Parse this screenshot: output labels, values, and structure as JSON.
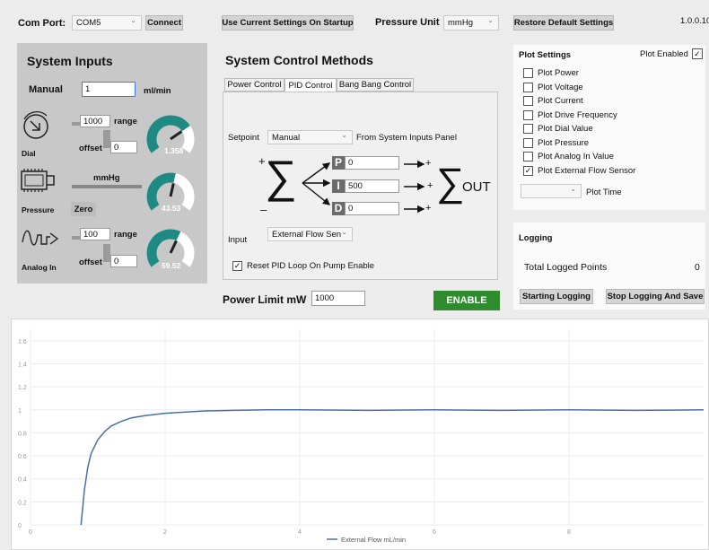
{
  "topbar": {
    "com_port_label": "Com Port:",
    "com_port_value": "COM5",
    "connect_label": "Connect",
    "use_current_label": "Use Current Settings On Startup",
    "pressure_unit_label": "Pressure Unit",
    "pressure_unit_value": "mmHg",
    "restore_label": "Restore Default Settings",
    "version": "1.0.0.10"
  },
  "system_inputs": {
    "title": "System Inputs",
    "manual_label": "Manual",
    "manual_value": "1",
    "manual_unit": "ml/min",
    "dial": {
      "label": "Dial",
      "range_label": "range",
      "range_value": "1000",
      "offset_label": "offset",
      "offset_value": "0",
      "gauge_value": "1.358",
      "gauge_fraction": 0.72
    },
    "pressure": {
      "label": "Pressure",
      "unit": "mmHg",
      "zero_label": "Zero",
      "gauge_value": "43.53",
      "gauge_fraction": 0.55
    },
    "analog": {
      "label": "Analog In",
      "range_label": "range",
      "range_value": "100",
      "offset_label": "offset",
      "offset_value": "0",
      "gauge_value": "59.52",
      "gauge_fraction": 0.6
    }
  },
  "control": {
    "title": "System Control Methods",
    "tabs": [
      "Power Control",
      "PID Control",
      "Bang Bang Control"
    ],
    "active_tab": 1,
    "setpoint_label": "Setpoint",
    "setpoint_value": "Manual",
    "setpoint_note": "From System Inputs Panel",
    "p_letter": "P",
    "p_value": "0",
    "i_letter": "I",
    "i_value": "500",
    "d_letter": "D",
    "d_value": "0",
    "out_label": "OUT",
    "plus": "+",
    "minus": "–",
    "input_label": "Input",
    "input_value": "External Flow Sen",
    "reset_label": "Reset PID Loop On Pump Enable",
    "reset_checked": true,
    "power_limit_label": "Power Limit mW",
    "power_limit_value": "1000",
    "enable_label": "ENABLE",
    "enable_color": "#2e8b2e"
  },
  "plot_settings": {
    "title": "Plot Settings",
    "plot_enabled_label": "Plot Enabled",
    "plot_enabled": true,
    "items": [
      {
        "label": "Plot Power",
        "checked": false
      },
      {
        "label": "Plot Voltage",
        "checked": false
      },
      {
        "label": "Plot Current",
        "checked": false
      },
      {
        "label": "Plot Drive Frequency",
        "checked": false
      },
      {
        "label": "Plot Dial Value",
        "checked": false
      },
      {
        "label": "Plot Pressure",
        "checked": false
      },
      {
        "label": "Plot Analog In Value",
        "checked": false
      },
      {
        "label": "Plot External Flow Sensor",
        "checked": true
      }
    ],
    "plot_time_label": "Plot Time",
    "plot_time_value": ""
  },
  "logging": {
    "title": "Logging",
    "total_label": "Total Logged Points",
    "total_value": "0",
    "start_label": "Starting Logging",
    "stop_label": "Stop Logging And Save"
  },
  "colors": {
    "gauge": "#1e8a83",
    "panel_gray": "#c8c8c8",
    "series": "#4a6fa5"
  },
  "chart_data": {
    "type": "line",
    "x_ticks": [
      "0",
      "2",
      "4",
      "6",
      "8"
    ],
    "y_ticks": [
      "0",
      "0.2",
      "0.4",
      "0.6",
      "0.8",
      "1",
      "1.2",
      "1.4",
      "1.6"
    ],
    "xlim": [
      0,
      10
    ],
    "ylim": [
      0,
      1.7
    ],
    "grid": true,
    "legend": "bottom",
    "series": [
      {
        "name": "External Flow mL/min",
        "x": [
          0.75,
          0.8,
          0.85,
          0.9,
          1.0,
          1.1,
          1.2,
          1.35,
          1.5,
          1.7,
          2.0,
          2.3,
          2.6,
          3.0,
          3.5,
          4.0,
          5.0,
          6.0,
          7.0,
          8.0,
          9.0,
          10.0
        ],
        "y": [
          0.0,
          0.3,
          0.5,
          0.62,
          0.74,
          0.81,
          0.86,
          0.9,
          0.93,
          0.95,
          0.97,
          0.98,
          0.99,
          0.995,
          1.0,
          1.0,
          0.995,
          1.0,
          0.995,
          1.0,
          0.995,
          1.0
        ]
      }
    ]
  }
}
